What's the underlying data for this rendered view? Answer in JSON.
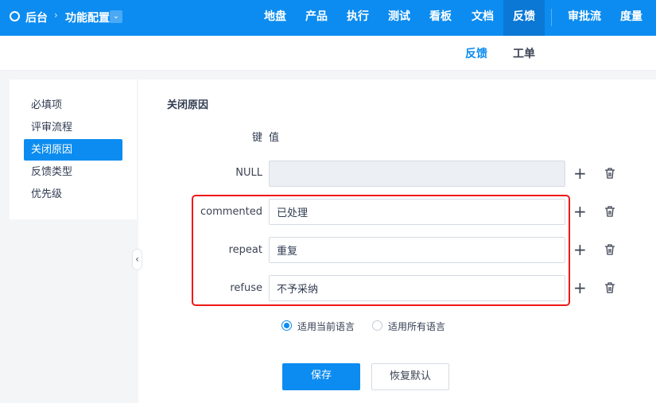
{
  "header": {
    "breadcrumb_root": "后台",
    "breadcrumb_current": "功能配置",
    "nav": [
      "地盘",
      "产品",
      "执行",
      "测试",
      "看板",
      "文档",
      "反馈",
      "审批流",
      "度量"
    ],
    "active_nav": "反馈"
  },
  "subnav": {
    "items": [
      "反馈",
      "工单"
    ],
    "active": "反馈"
  },
  "sidebar": {
    "items": [
      "必填项",
      "评审流程",
      "关闭原因",
      "反馈类型",
      "优先级"
    ],
    "active": "关闭原因"
  },
  "main": {
    "title": "关闭原因",
    "key_header": "键",
    "value_header": "值",
    "rows": [
      {
        "key": "NULL",
        "value": ""
      },
      {
        "key": "commented",
        "value": "已处理"
      },
      {
        "key": "repeat",
        "value": "重复"
      },
      {
        "key": "refuse",
        "value": "不予采纳"
      }
    ],
    "radio_options": [
      "适用当前语言",
      "适用所有语言"
    ],
    "radio_selected": "适用当前语言",
    "save_label": "保存",
    "reset_label": "恢复默认"
  },
  "colors": {
    "primary": "#0c8cf0",
    "highlight": "#f01818"
  }
}
